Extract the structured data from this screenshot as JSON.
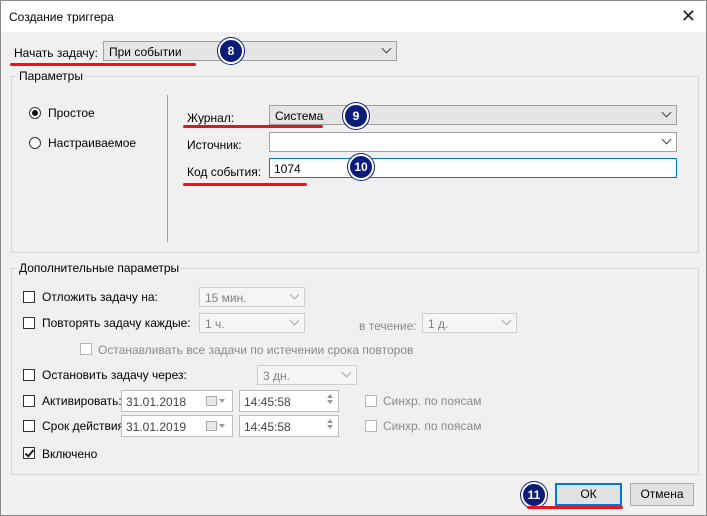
{
  "window": {
    "title": "Создание триггера",
    "close_glyph": "✕"
  },
  "start_task": {
    "label": "Начать задачу:",
    "value": "При событии",
    "badge": "8"
  },
  "params": {
    "legend": "Параметры",
    "radio_simple": "Простое",
    "radio_custom": "Настраиваемое",
    "log_label": "Журнал:",
    "log_value": "Система",
    "log_badge": "9",
    "source_label": "Источник:",
    "source_value": "",
    "event_id_label": "Код события:",
    "event_id_value": "1074",
    "event_badge": "10"
  },
  "advanced": {
    "legend": "Дополнительные параметры",
    "delay_label": "Отложить задачу на:",
    "delay_value": "15 мин.",
    "repeat_label": "Повторять задачу каждые:",
    "repeat_value": "1 ч.",
    "duration_label": "в течение:",
    "duration_value": "1 д.",
    "stop_all_label": "Останавливать все задачи по истечении срока повторов",
    "stop_after_label": "Остановить задачу через:",
    "stop_after_value": "3 дн.",
    "activate_label": "Активировать:",
    "activate_date": "31.01.2018",
    "activate_time": "14:45:58",
    "activate_sync": "Синхр. по поясам",
    "expire_label": "Срок действия:",
    "expire_date": "31.01.2019",
    "expire_time": "14:45:58",
    "expire_sync": "Синхр. по поясам",
    "enabled_label": "Включено",
    "enabled_checked": true
  },
  "buttons": {
    "ok": "ОК",
    "cancel": "Отмена",
    "ok_badge": "11"
  },
  "colors": {
    "annotation_badge": "#0c1c7a",
    "annotation_line": "#e8141c",
    "focus": "#0078d7"
  }
}
